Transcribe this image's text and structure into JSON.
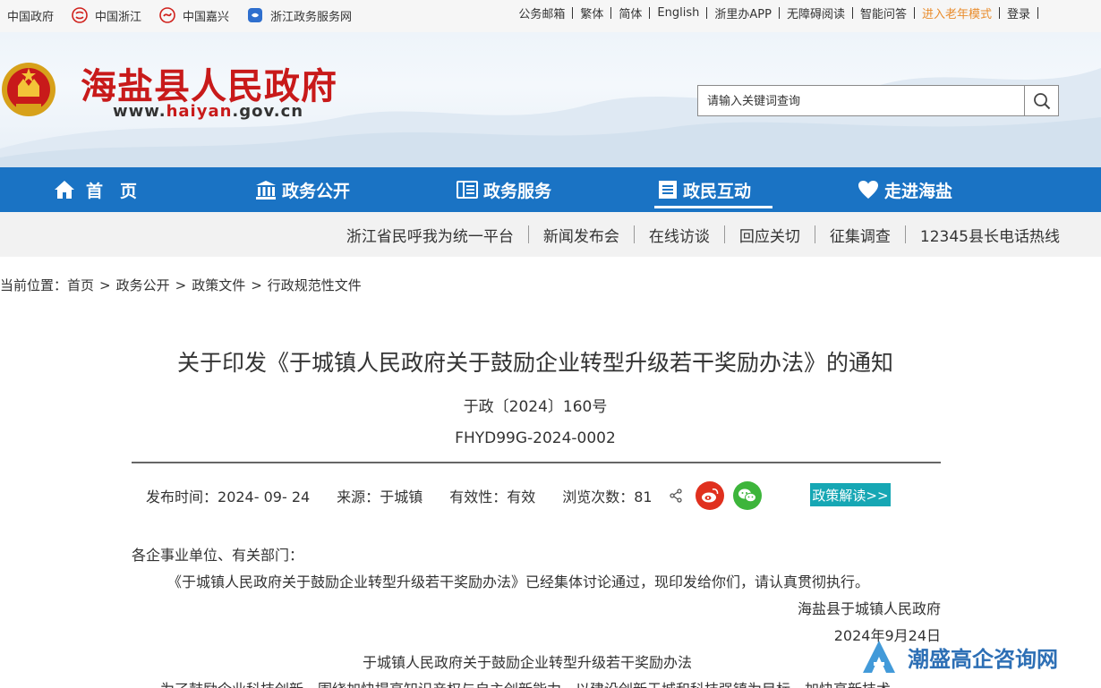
{
  "topbar": {
    "left_links": [
      {
        "label": "中国政府",
        "icon": "none"
      },
      {
        "label": "中国浙江",
        "icon": "zhejiang-logo-icon"
      },
      {
        "label": "中国嘉兴",
        "icon": "jiaxing-logo-icon"
      },
      {
        "label": "浙江政务服务网",
        "icon": "zjzwfw-logo-icon"
      }
    ],
    "right_links": [
      "公务邮箱",
      "繁体",
      "简体",
      "English",
      "浙里办APP",
      "无障碍阅读",
      "智能问答",
      "进入老年模式",
      "登录"
    ],
    "elder_color": "#e98c2c"
  },
  "header": {
    "site_title": "海盐县人民政府",
    "url_prefix": "www.",
    "url_highlight": "haiyan",
    "url_suffix": ".gov.cn",
    "search_placeholder": "请输入关键词查询",
    "brand_red": "#c81a1a"
  },
  "nav": {
    "color": "#1a73c4",
    "items": [
      {
        "label": "首　页",
        "icon": "home-icon"
      },
      {
        "label": "政务公开",
        "icon": "building-icon"
      },
      {
        "label": "政务服务",
        "icon": "book-icon"
      },
      {
        "label": "政民互动",
        "icon": "list-icon",
        "active": true
      },
      {
        "label": "走进海盐",
        "icon": "heart-icon"
      }
    ]
  },
  "subnav": {
    "items": [
      "浙江省民呼我为统一平台",
      "新闻发布会",
      "在线访谈",
      "回应关切",
      "征集调查",
      "12345县长电话热线"
    ]
  },
  "breadcrumb": {
    "prefix": "当前位置：",
    "items": [
      "首页",
      "政务公开",
      "政策文件",
      "行政规范性文件"
    ],
    "separator": ">"
  },
  "article": {
    "title": "关于印发《于城镇人民政府关于鼓励企业转型升级若干奖励办法》的通知",
    "doc_number": "于政〔2024〕160号",
    "doc_id": "FHYD99G-2024-0002",
    "meta": {
      "publish_label": "发布时间：",
      "publish_date": "2024- 09- 24",
      "source_label": "来源：",
      "source": "于城镇",
      "validity_label": "有效性：",
      "validity": "有效",
      "views_label": "浏览次数：",
      "views": "81"
    },
    "interpret_button": "政策解读>>",
    "salutation": "各企事业单位、有关部门：",
    "paragraph": "《于城镇人民政府关于鼓励企业转型升级若干奖励办法》已经集体讨论通过，现印发给你们，请认真贯彻执行。",
    "signature": "海盐县于城镇人民政府",
    "sign_date": "2024年9月24日",
    "sub_title": "于城镇人民政府关于鼓励企业转型升级若干奖励办法",
    "next_line": "为了鼓励企业科技创新，围绕加快提高知识产权与自主创新能力，以建设创新于城和科技强镇为目标，加快高新技术"
  },
  "watermark": {
    "text": "潮盛高企咨询网"
  }
}
